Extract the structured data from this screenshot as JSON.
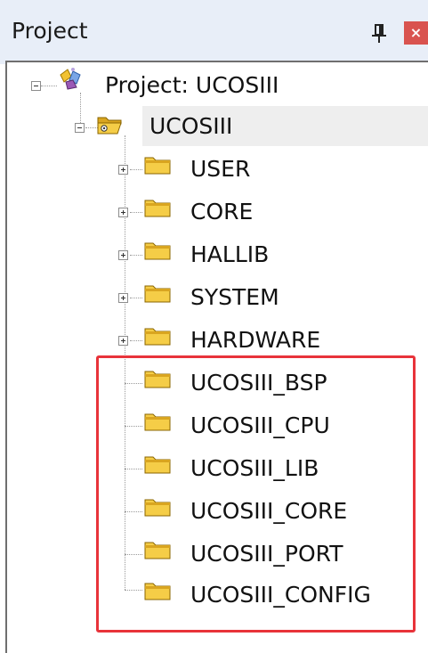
{
  "panel": {
    "title": "Project",
    "close_glyph": "×"
  },
  "icons": {
    "pin": "pin-icon",
    "close": "close-icon",
    "project": "project-icon",
    "folder": "folder-icon",
    "folder_open": "folder-open-icon"
  },
  "colors": {
    "titlebar_bg": "#e8eef8",
    "close_bg": "#d9534f",
    "folder_fill": "#f5cd47",
    "highlight": "#e8333a",
    "selection_bg": "#eeeeee"
  },
  "tree": {
    "root": {
      "label": "Project: UCOSIII",
      "expanded": true
    },
    "group": {
      "label": "UCOSIII",
      "expanded": true
    },
    "children": [
      {
        "label": "USER",
        "expandable": true
      },
      {
        "label": "CORE",
        "expandable": true
      },
      {
        "label": "HALLIB",
        "expandable": true
      },
      {
        "label": "SYSTEM",
        "expandable": true
      },
      {
        "label": "HARDWARE",
        "expandable": true
      },
      {
        "label": "UCOSIII_BSP",
        "expandable": false
      },
      {
        "label": "UCOSIII_CPU",
        "expandable": false
      },
      {
        "label": "UCOSIII_LIB",
        "expandable": false
      },
      {
        "label": "UCOSIII_CORE",
        "expandable": false
      },
      {
        "label": "UCOSIII_PORT",
        "expandable": false
      },
      {
        "label": "UCOSIII_CONFIG",
        "expandable": false
      }
    ]
  }
}
